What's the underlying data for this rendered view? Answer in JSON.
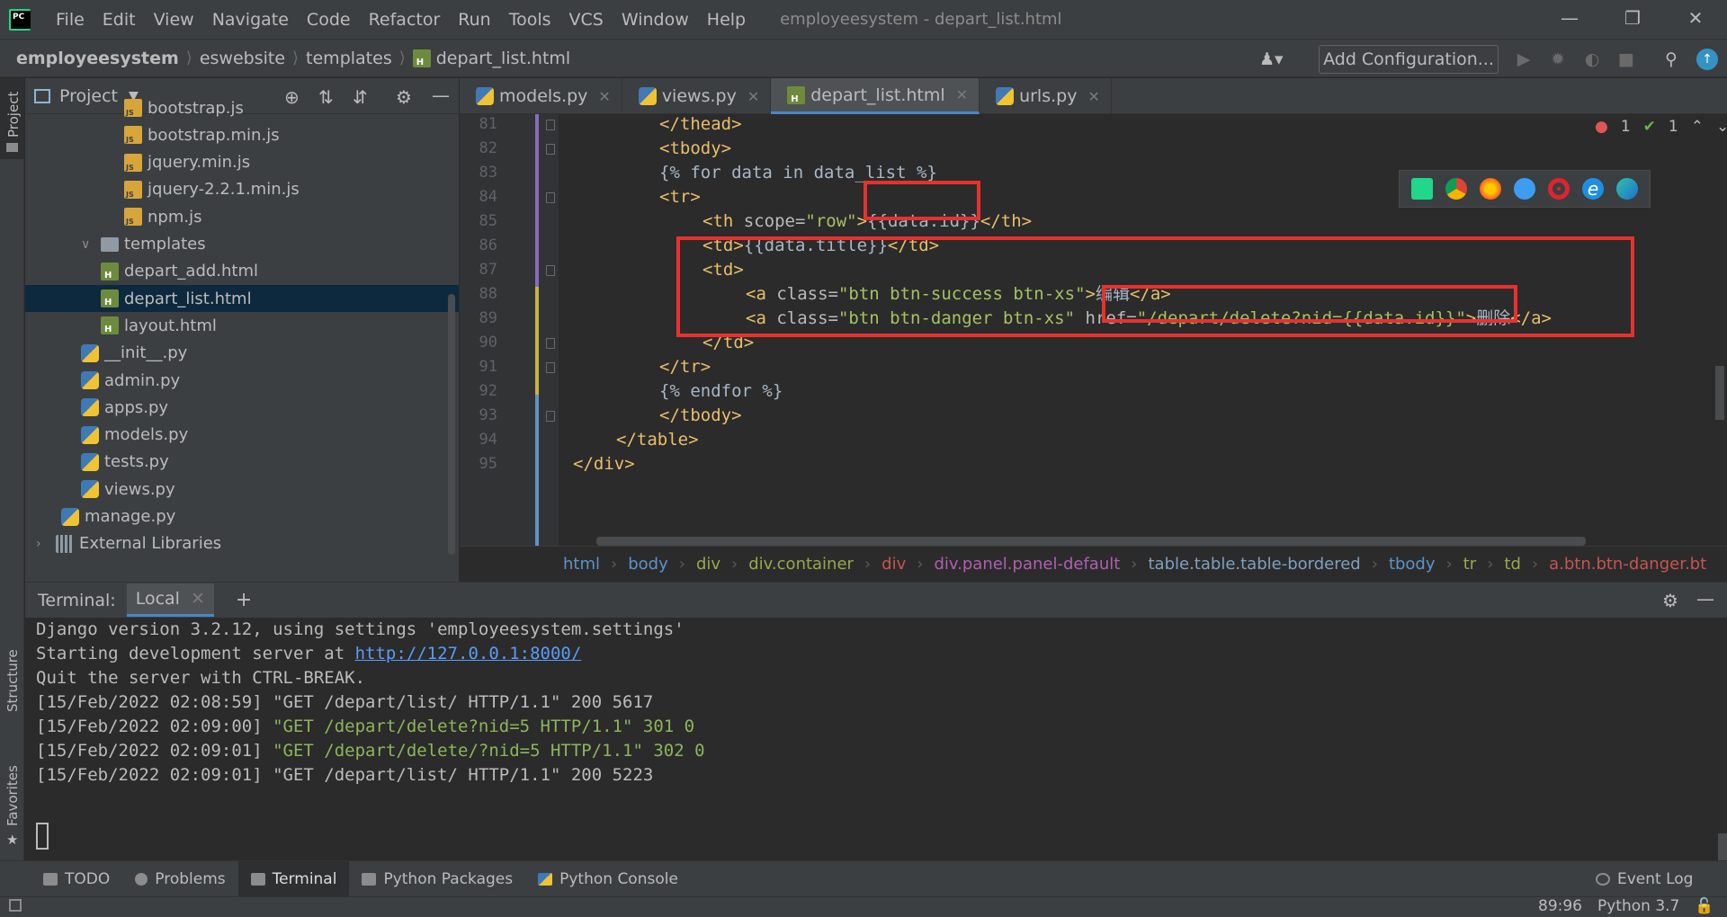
{
  "app": {
    "menu": [
      "File",
      "Edit",
      "View",
      "Navigate",
      "Code",
      "Refactor",
      "Run",
      "Tools",
      "VCS",
      "Window",
      "Help"
    ],
    "window_title": "employeesystem - depart_list.html"
  },
  "breadcrumb": [
    "employeesystem",
    "eswebsite",
    "templates",
    "depart_list.html"
  ],
  "toolbar": {
    "run_config_label": "Add Configuration..."
  },
  "project": {
    "title": "Project",
    "tree": [
      {
        "label": "bootstrap.js",
        "type": "js",
        "indent": 4
      },
      {
        "label": "bootstrap.min.js",
        "type": "js",
        "indent": 4
      },
      {
        "label": "jquery.min.js",
        "type": "js",
        "indent": 4
      },
      {
        "label": "jquery-2.2.1.min.js",
        "type": "js",
        "indent": 4
      },
      {
        "label": "npm.js",
        "type": "js",
        "indent": 4
      },
      {
        "label": "templates",
        "type": "folder",
        "indent": 2,
        "expanded": true
      },
      {
        "label": "depart_add.html",
        "type": "html",
        "indent": 3
      },
      {
        "label": "depart_list.html",
        "type": "html",
        "indent": 3,
        "selected": true
      },
      {
        "label": "layout.html",
        "type": "html",
        "indent": 3
      },
      {
        "label": "__init__.py",
        "type": "py",
        "indent": 2
      },
      {
        "label": "admin.py",
        "type": "py",
        "indent": 2
      },
      {
        "label": "apps.py",
        "type": "py",
        "indent": 2
      },
      {
        "label": "models.py",
        "type": "py",
        "indent": 2
      },
      {
        "label": "tests.py",
        "type": "py",
        "indent": 2
      },
      {
        "label": "views.py",
        "type": "py",
        "indent": 2
      },
      {
        "label": "manage.py",
        "type": "py",
        "indent": 1
      },
      {
        "label": "External Libraries",
        "type": "lib",
        "indent": 0,
        "collapsed": true
      }
    ]
  },
  "editor": {
    "tabs": [
      {
        "label": "models.py",
        "active": false
      },
      {
        "label": "views.py",
        "active": false
      },
      {
        "label": "depart_list.html",
        "active": true
      },
      {
        "label": "urls.py",
        "active": false
      }
    ],
    "inspections": {
      "errors": "1",
      "warnings": "1"
    },
    "lines": [
      {
        "num": "81",
        "indent": 2,
        "segs": [
          [
            "tag",
            "</thead>"
          ]
        ]
      },
      {
        "num": "82",
        "indent": 2,
        "segs": [
          [
            "tag",
            "<tbody>"
          ]
        ]
      },
      {
        "num": "83",
        "indent": 2,
        "segs": [
          [
            "tpl",
            "{% for data in data_list %}"
          ]
        ]
      },
      {
        "num": "84",
        "indent": 2,
        "segs": [
          [
            "tag",
            "<tr>"
          ]
        ]
      },
      {
        "num": "85",
        "indent": 3,
        "segs": [
          [
            "tag",
            "<th "
          ],
          [
            "attr",
            "scope="
          ],
          [
            "str",
            "\"row\""
          ],
          [
            "tag",
            ">"
          ],
          [
            "tpl",
            "{{data.id}}"
          ],
          [
            "tag",
            "</th>"
          ]
        ]
      },
      {
        "num": "86",
        "indent": 3,
        "segs": [
          [
            "tag",
            "<td>"
          ],
          [
            "tpl",
            "{{data.title}}"
          ],
          [
            "tag",
            "</td>"
          ]
        ]
      },
      {
        "num": "87",
        "indent": 3,
        "segs": [
          [
            "tag",
            "<td>"
          ]
        ]
      },
      {
        "num": "88",
        "indent": 4,
        "segs": [
          [
            "tag",
            "<a "
          ],
          [
            "attr",
            "class="
          ],
          [
            "str",
            "\"btn btn-success btn-xs\""
          ],
          [
            "tag",
            ">"
          ],
          [
            "tpl",
            "编辑"
          ],
          [
            "tag",
            "</a>"
          ]
        ]
      },
      {
        "num": "89",
        "indent": 4,
        "segs": [
          [
            "tag",
            "<a "
          ],
          [
            "attr",
            "class="
          ],
          [
            "str",
            "\"btn btn-danger btn-xs\" "
          ],
          [
            "attr",
            "href="
          ],
          [
            "str",
            "\"/depart/delete?nid={{data.id}}\""
          ],
          [
            "tag",
            ">"
          ],
          [
            "tpl",
            "删除"
          ],
          [
            "tag",
            "</a>"
          ]
        ]
      },
      {
        "num": "90",
        "indent": 3,
        "segs": [
          [
            "tag",
            "</td>"
          ]
        ]
      },
      {
        "num": "91",
        "indent": 2,
        "segs": [
          [
            "tag",
            "</tr>"
          ]
        ]
      },
      {
        "num": "92",
        "indent": 2,
        "segs": [
          [
            "tpl",
            "{% endfor %}"
          ]
        ]
      },
      {
        "num": "93",
        "indent": 2,
        "segs": [
          [
            "tag",
            "</tbody>"
          ]
        ]
      },
      {
        "num": "94",
        "indent": 1,
        "segs": [
          [
            "tag",
            "</table>"
          ]
        ]
      },
      {
        "num": "95",
        "indent": 0,
        "segs": [
          [
            "tag",
            "</div>"
          ]
        ]
      }
    ],
    "code_breadcrumbs": [
      "html",
      "body",
      "div",
      "div.container",
      "div",
      "div.panel.panel-default",
      "table.table.table-bordered",
      "tbody",
      "tr",
      "td",
      "a.btn.btn-danger.bt"
    ]
  },
  "terminal": {
    "label": "Terminal:",
    "tab": "Local",
    "lines": [
      {
        "text": "Django version 3.2.12, using settings 'employeesystem.settings'"
      },
      {
        "prefix": "Starting development server at ",
        "link": "http://127.0.0.1:8000/"
      },
      {
        "text": "Quit the server with CTRL-BREAK."
      },
      {
        "text": "[15/Feb/2022 02:08:59] \"GET /depart/list/ HTTP/1.1\" 200 5617"
      },
      {
        "prefix": "[15/Feb/2022 02:09:00] ",
        "green": "\"GET /depart/delete?nid=5 HTTP/1.1\" 301 0"
      },
      {
        "prefix": "[15/Feb/2022 02:09:01] ",
        "green": "\"GET /depart/delete/?nid=5 HTTP/1.1\" 302 0"
      },
      {
        "text": "[15/Feb/2022 02:09:01] \"GET /depart/list/ HTTP/1.1\" 200 5223"
      }
    ]
  },
  "tool_windows": {
    "todo": "TODO",
    "problems": "Problems",
    "terminal": "Terminal",
    "python_packages": "Python Packages",
    "python_console": "Python Console",
    "event_log": "Event Log"
  },
  "side_tools": {
    "project": "Project",
    "structure": "Structure",
    "favorites": "Favorites"
  },
  "status": {
    "position": "89:96",
    "interpreter": "Python 3.7"
  },
  "colors": {
    "accent": "#4a88c7",
    "highlight_box": "#e8312f",
    "selection": "#0d293e"
  }
}
